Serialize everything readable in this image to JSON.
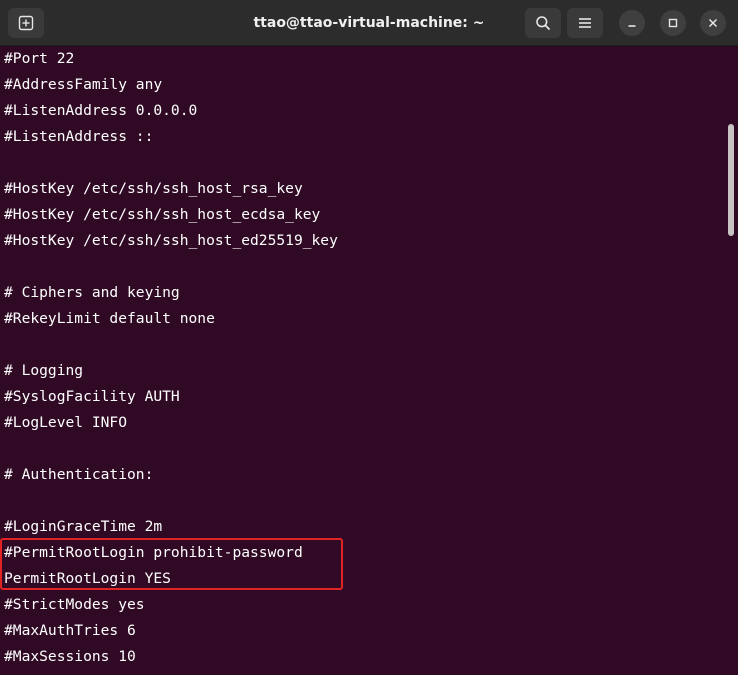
{
  "window": {
    "title": "ttao@ttao-virtual-machine: ~"
  },
  "toolbar": {
    "new_tab_icon": "new-tab-icon",
    "search_icon": "search-icon",
    "menu_icon": "hamburger-menu-icon",
    "minimize_icon": "minimize-icon",
    "maximize_icon": "maximize-icon",
    "close_icon": "close-icon"
  },
  "terminal": {
    "lines": [
      "#Port 22",
      "#AddressFamily any",
      "#ListenAddress 0.0.0.0",
      "#ListenAddress ::",
      "",
      "#HostKey /etc/ssh/ssh_host_rsa_key",
      "#HostKey /etc/ssh/ssh_host_ecdsa_key",
      "#HostKey /etc/ssh/ssh_host_ed25519_key",
      "",
      "# Ciphers and keying",
      "#RekeyLimit default none",
      "",
      "# Logging",
      "#SyslogFacility AUTH",
      "#LogLevel INFO",
      "",
      "# Authentication:",
      "",
      "#LoginGraceTime 2m",
      "#PermitRootLogin prohibit-password",
      "PermitRootLogin YES",
      "#StrictModes yes",
      "#MaxAuthTries 6",
      "#MaxSessions 10"
    ]
  },
  "colors": {
    "terminal_bg": "#300a24",
    "titlebar_bg": "#2c2c2c",
    "highlight_border": "#e02424",
    "text": "#ffffff"
  }
}
